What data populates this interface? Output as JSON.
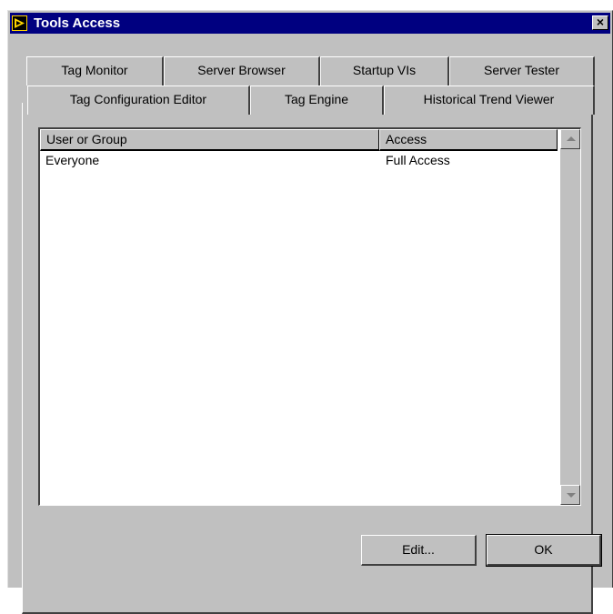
{
  "window": {
    "title": "Tools Access",
    "close_label": "×",
    "app_icon": "labview-run-icon"
  },
  "tabs": {
    "row_back": [
      {
        "label": "Tag Monitor"
      },
      {
        "label": "Server Browser"
      },
      {
        "label": "Startup VIs"
      },
      {
        "label": "Server Tester"
      }
    ],
    "row_front": [
      {
        "label": "Tag Configuration Editor",
        "selected": true
      },
      {
        "label": "Tag Engine"
      },
      {
        "label": "Historical Trend Viewer"
      }
    ]
  },
  "table": {
    "columns": [
      "User or Group",
      "Access"
    ],
    "rows": [
      {
        "user": "Everyone",
        "access": "Full Access"
      }
    ]
  },
  "buttons": {
    "edit": "Edit...",
    "ok": "OK"
  }
}
